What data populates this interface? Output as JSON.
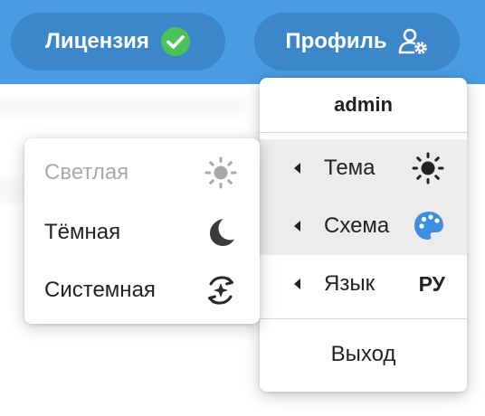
{
  "header": {
    "license_label": "Лицензия",
    "license_icon": "check-circle-icon",
    "profile_label": "Профиль",
    "profile_icon": "user-settings-icon"
  },
  "profile_menu": {
    "username": "admin",
    "items": [
      {
        "label": "Тема",
        "icon": "sun-icon"
      },
      {
        "label": "Схема",
        "icon": "palette-icon"
      },
      {
        "label": "Язык",
        "value": "РУ"
      }
    ],
    "logout_label": "Выход"
  },
  "theme_menu": {
    "options": [
      {
        "label": "Светлая",
        "icon": "sun-icon",
        "disabled": true
      },
      {
        "label": "Тёмная",
        "icon": "moon-icon"
      },
      {
        "label": "Системная",
        "icon": "auto-theme-icon"
      }
    ]
  },
  "colors": {
    "header_bg": "#4a9de2",
    "pill_bg": "#3b87c9",
    "check_green": "#4cc35a",
    "palette_blue": "#3d8fe0"
  }
}
